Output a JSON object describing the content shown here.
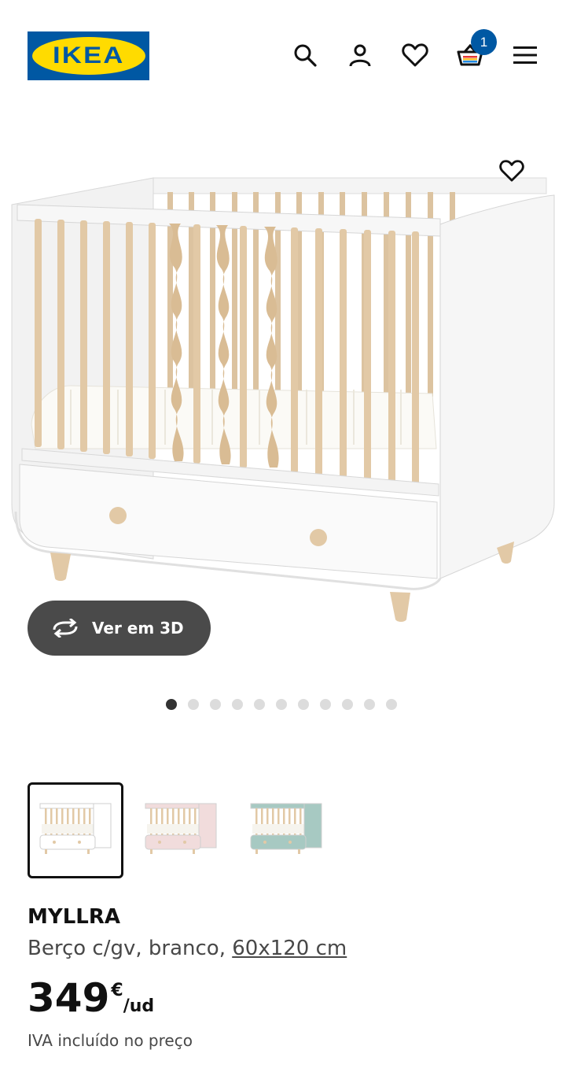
{
  "header": {
    "logo_text": "IKEA",
    "cart_count": "1",
    "icons": [
      "search-icon",
      "user-icon",
      "heart-icon",
      "cart-icon",
      "menu-icon"
    ]
  },
  "gallery": {
    "view_3d_label": "Ver em 3D",
    "image_count": 11,
    "active_index": 0
  },
  "variants": [
    {
      "color_name": "branco",
      "frame": "#ffffff",
      "selected": true
    },
    {
      "color_name": "rosa",
      "frame": "#f1dcdc",
      "selected": false
    },
    {
      "color_name": "turquesa",
      "frame": "#a7c9c2",
      "selected": false
    }
  ],
  "product": {
    "name": "MYLLRA",
    "description": "Berço c/gv, branco, ",
    "size": "60x120 cm",
    "price_integer": "349",
    "currency": "€",
    "unit": "/ud",
    "vat_note": "IVA incluído no preço"
  },
  "colors": {
    "brand_blue": "#0058a3",
    "brand_yellow": "#ffdb00",
    "wood": "#e2c9a6"
  }
}
